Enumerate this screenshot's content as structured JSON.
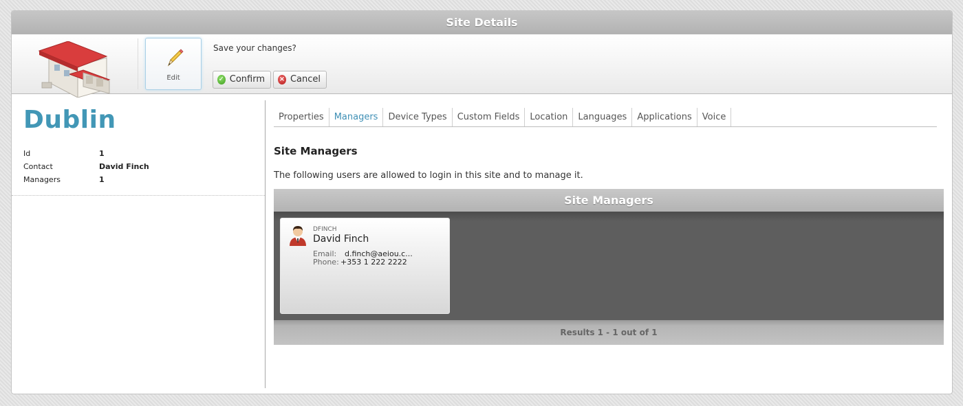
{
  "window": {
    "title": "Site Details"
  },
  "toolbar": {
    "edit_label": "Edit",
    "prompt": "Save your changes?",
    "confirm_label": "Confirm",
    "cancel_label": "Cancel",
    "icons": [
      "building-icon",
      "pencil-icon",
      "check-icon",
      "close-icon"
    ]
  },
  "site": {
    "name": "Dublin",
    "fields": [
      {
        "label": "Id",
        "value": "1"
      },
      {
        "label": "Contact",
        "value": "David Finch"
      },
      {
        "label": "Managers",
        "value": "1"
      }
    ]
  },
  "tabs": [
    {
      "label": "Properties",
      "active": false
    },
    {
      "label": "Managers",
      "active": true
    },
    {
      "label": "Device Types",
      "active": false
    },
    {
      "label": "Custom Fields",
      "active": false
    },
    {
      "label": "Location",
      "active": false
    },
    {
      "label": "Languages",
      "active": false
    },
    {
      "label": "Applications",
      "active": false
    },
    {
      "label": "Voice",
      "active": false
    }
  ],
  "managers_section": {
    "title": "Site Managers",
    "description": "The following users are allowed to login in this site and to manage it.",
    "grid_title": "Site Managers",
    "cards": [
      {
        "username": "DFINCH",
        "name": "David Finch",
        "email_label": "Email:",
        "email": "d.finch@aeiou.c...",
        "phone_label": "Phone:",
        "phone": "+353 1 222 2222"
      }
    ],
    "results": "Results 1 - 1 out of 1"
  },
  "colors": {
    "accent": "#4297b6",
    "active_tab": "#3e8fb5",
    "grid_background": "#5e5e5e",
    "header_gray": "#b7b7b7"
  }
}
